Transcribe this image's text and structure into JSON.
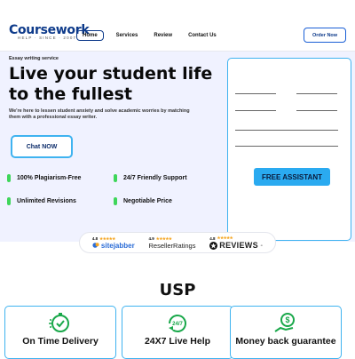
{
  "header": {
    "logo_word": "oursework",
    "logo_initial": "C",
    "logo_tagline": "HELP · SINCE · 2007",
    "nav": [
      {
        "label": "Home",
        "active": true
      },
      {
        "label": "Services",
        "active": false
      },
      {
        "label": "Review",
        "active": false
      },
      {
        "label": "Contact Us",
        "active": false
      }
    ],
    "order_label": "Order Now"
  },
  "hero": {
    "eyebrow": "Essay writing service",
    "title": "Live your student life to the fullest",
    "description": "We're here to lessen student anxiety and solve academic worries by matching them with a professional essay writer.",
    "chat_label": "Chat NOW",
    "features": [
      "100% Plagiarism-Free",
      "24/7 Friendly Support",
      "Unlimited Revisions",
      "Negotiable Price"
    ],
    "assistant_label": "FREE ASSISTANT"
  },
  "ratings": [
    {
      "score": "4.8",
      "brand": "sitejabber"
    },
    {
      "score": "4.9",
      "brand": "ResellerRatings"
    },
    {
      "score": "4.8",
      "brand": "REVIEWS",
      "suffix": ".io"
    }
  ],
  "usp": {
    "title": "USP",
    "cards": [
      {
        "label": "On Time Delivery",
        "icon": "clock-check-icon"
      },
      {
        "label": "24X7 Live Help",
        "icon": "phone-247-icon"
      },
      {
        "label": "Money back guarantee",
        "icon": "money-hand-icon"
      }
    ]
  },
  "colors": {
    "brand": "#0d3a8a",
    "accent": "#2aaaf0",
    "hero_bg": "#f0f2ff",
    "feature_dot": "#3ed65a",
    "icon_green": "#19a84a"
  }
}
